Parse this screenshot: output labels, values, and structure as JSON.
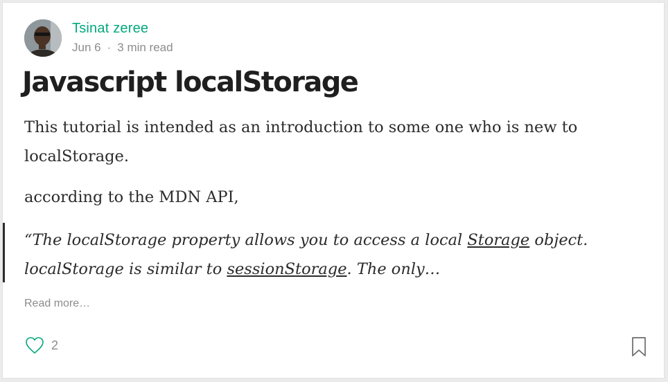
{
  "post": {
    "author": "Tsinat zeree",
    "date": "Jun 6",
    "separator": "·",
    "read_time": "3 min read",
    "title": "Javascript localStorage",
    "paragraph1": "This tutorial is intended as an introduction to some one who is new to localStorage.",
    "paragraph2": "according to the MDN API,",
    "quote": {
      "part1": "“The localStorage property allows you to access a local ",
      "link1": "Storage",
      "part2": " object. localStorage is similar to ",
      "link2": "sessionStorage",
      "part3": ". The only…"
    },
    "read_more": "Read more…",
    "likes": "2"
  },
  "icons": {
    "like": "heart-icon",
    "bookmark": "bookmark-icon"
  },
  "colors": {
    "accent": "#03a87c",
    "text": "#2b2b2b",
    "muted": "#8c8c8c"
  }
}
